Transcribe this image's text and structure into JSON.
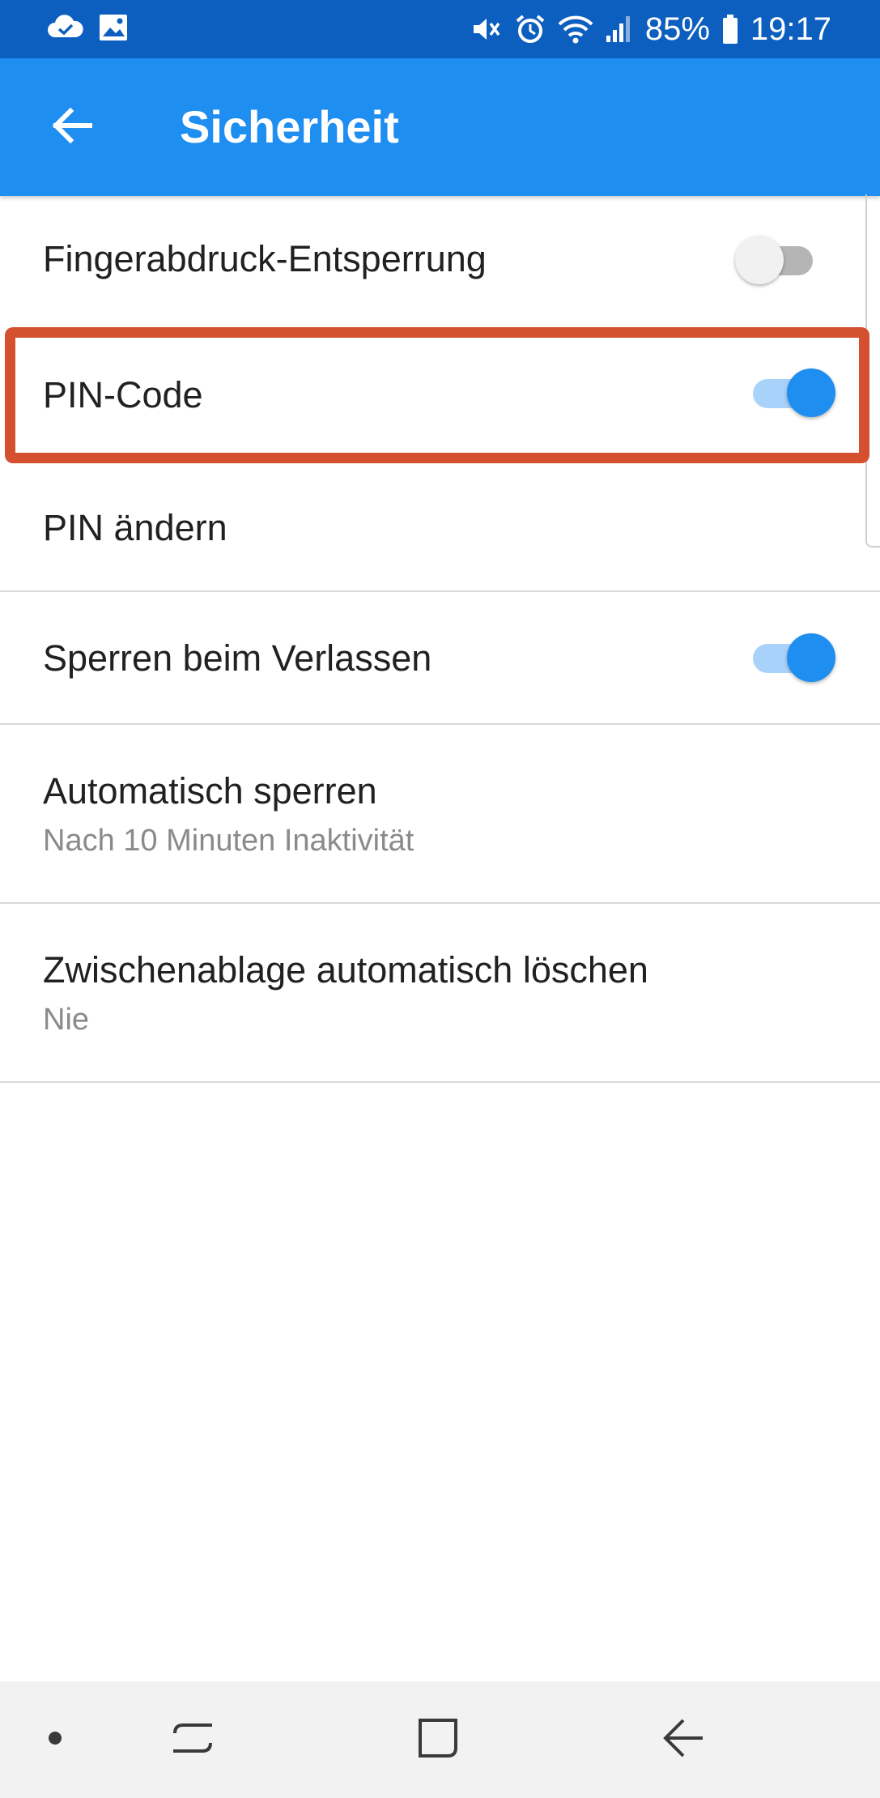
{
  "status_bar": {
    "battery": "85%",
    "time": "19:17",
    "left_icons": [
      "cloud-check-icon",
      "image-icon"
    ],
    "right_icons": [
      "mute-icon",
      "alarm-icon",
      "wifi-icon",
      "signal-icon",
      "battery-icon"
    ]
  },
  "app_bar": {
    "back_icon": "arrow-left-icon",
    "title": "Sicherheit"
  },
  "settings": {
    "fingerprint": {
      "label": "Fingerabdruck-Entsperrung",
      "enabled": false
    },
    "pin_code": {
      "label": "PIN-Code",
      "enabled": true
    },
    "change_pin": {
      "label": "PIN ändern"
    },
    "lock_on_exit": {
      "label": "Sperren beim Verlassen",
      "enabled": true
    },
    "auto_lock": {
      "label": "Automatisch sperren",
      "value": "Nach 10 Minuten Inaktivität"
    },
    "clipboard": {
      "label": "Zwischenablage automatisch löschen",
      "value": "Nie"
    }
  },
  "nav_bar": {
    "icons": [
      "dot-icon",
      "recent-apps-icon",
      "home-icon",
      "back-icon"
    ]
  },
  "colors": {
    "status_bar": "#0d5fbf",
    "app_bar": "#1f8ef1",
    "toggle_on": "#1f8ef1",
    "highlight": "#d4502f"
  }
}
